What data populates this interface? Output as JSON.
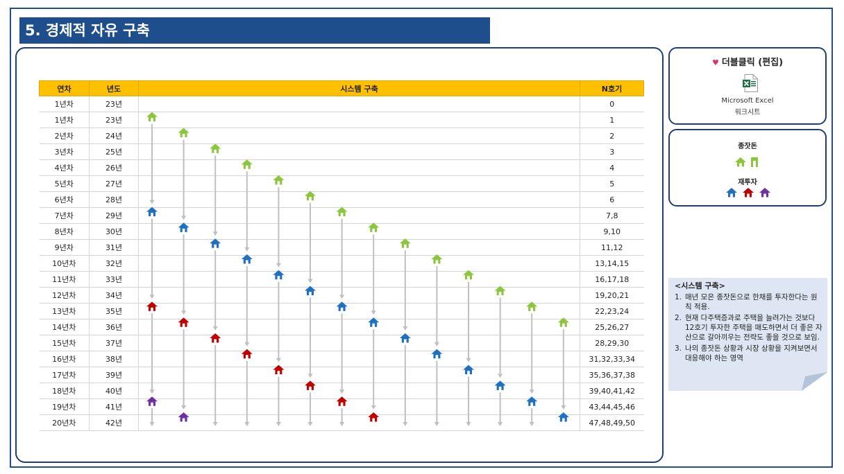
{
  "title": "5. 경제적 자유 구축",
  "table": {
    "headers": {
      "year": "연차",
      "calendar": "년도",
      "system": "시스템 구축",
      "n": "N호기"
    },
    "rows": [
      {
        "year": "1년차",
        "calendar": "23년",
        "n": "0"
      },
      {
        "year": "1년차",
        "calendar": "23년",
        "n": "1"
      },
      {
        "year": "2년차",
        "calendar": "24년",
        "n": "2"
      },
      {
        "year": "3년차",
        "calendar": "25년",
        "n": "3"
      },
      {
        "year": "4년차",
        "calendar": "26년",
        "n": "4"
      },
      {
        "year": "5년차",
        "calendar": "27년",
        "n": "5"
      },
      {
        "year": "6년차",
        "calendar": "28년",
        "n": "6"
      },
      {
        "year": "7년차",
        "calendar": "29년",
        "n": "7,8"
      },
      {
        "year": "8년차",
        "calendar": "30년",
        "n": "9,10"
      },
      {
        "year": "9년차",
        "calendar": "31년",
        "n": "11,12"
      },
      {
        "year": "10년차",
        "calendar": "32년",
        "n": "13,14,15"
      },
      {
        "year": "11년차",
        "calendar": "33년",
        "n": "16,17,18"
      },
      {
        "year": "12년차",
        "calendar": "34년",
        "n": "19,20,21"
      },
      {
        "year": "13년차",
        "calendar": "35년",
        "n": "22,23,24"
      },
      {
        "year": "14년차",
        "calendar": "36년",
        "n": "25,26,27"
      },
      {
        "year": "15년차",
        "calendar": "37년",
        "n": "28,29,30"
      },
      {
        "year": "16년차",
        "calendar": "38년",
        "n": "31,32,33,34"
      },
      {
        "year": "17년차",
        "calendar": "39년",
        "n": "35,36,37,38"
      },
      {
        "year": "18년차",
        "calendar": "40년",
        "n": "39,40,41,42"
      },
      {
        "year": "19년차",
        "calendar": "41년",
        "n": "43,44,45,46"
      },
      {
        "year": "20년차",
        "calendar": "42년",
        "n": "47,48,49,50"
      }
    ]
  },
  "house_colors": {
    "seed": "#8cc63f",
    "gen1": "#1f70c1",
    "gen2": "#c00000",
    "gen3": "#7030a0",
    "arrow": "#bfbfbf"
  },
  "diagram": {
    "columns": 14,
    "start_rows": [
      1,
      2,
      3,
      4,
      5,
      6,
      7,
      8,
      9,
      10,
      11,
      12,
      13,
      14
    ],
    "cycle": 6,
    "last_row": 20
  },
  "edit_box": {
    "title": "더블클릭 (편집)",
    "file_type_line1": "Microsoft Excel",
    "file_type_line2": "워크시트",
    "icon": "excel-icon"
  },
  "legend": {
    "seed_label": "종잣돈",
    "reinvest_label": "재투자"
  },
  "note": {
    "title": "<시스템 구축>",
    "items": [
      {
        "num": "1.",
        "text": "매년 모은 종잣돈으로 한채를 투자한다는 원칙 적용."
      },
      {
        "num": "2.",
        "text": "현재 다주택증과로 주택을 늘려가는 것보다 12호기 투자한 주택을 매도하면서 더 좋은 자산으로 갈아끼우는 전략도 좋을 것으로 보임."
      },
      {
        "num": "3.",
        "text": "나의 종잣돈 상황과 시장 상황을 지켜보면서 대응해야 하는 영역"
      }
    ]
  }
}
